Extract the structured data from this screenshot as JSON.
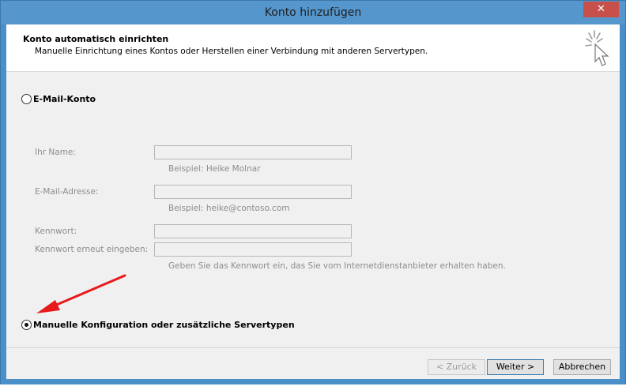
{
  "window": {
    "title": "Konto hinzufügen",
    "close_symbol": "✕"
  },
  "header": {
    "title": "Konto automatisch einrichten",
    "subtitle": "Manuelle Einrichtung eines Kontos oder Herstellen einer Verbindung mit anderen Servertypen.",
    "icon": "wizard-cursor-icon"
  },
  "options": {
    "email_account": {
      "label": "E-Mail-Konto",
      "selected": false
    },
    "manual": {
      "label": "Manuelle Konfiguration oder zusätzliche Servertypen",
      "selected": true
    }
  },
  "form": {
    "name_label": "Ihr Name:",
    "name_value": "",
    "name_hint": "Beispiel: Heike Molnar",
    "email_label": "E-Mail-Adresse:",
    "email_value": "",
    "email_hint": "Beispiel: heike@contoso.com",
    "password_label": "Kennwort:",
    "password_repeat_label": "Kennwort erneut eingeben:",
    "password_hint": "Geben Sie das Kennwort ein, das Sie vom Internetdienstanbieter erhalten haben."
  },
  "buttons": {
    "back": "< Zurück",
    "next": "Weiter >",
    "cancel": "Abbrechen"
  },
  "annotation": {
    "color": "#e8191b",
    "icon": "red-arrow-annotation"
  }
}
